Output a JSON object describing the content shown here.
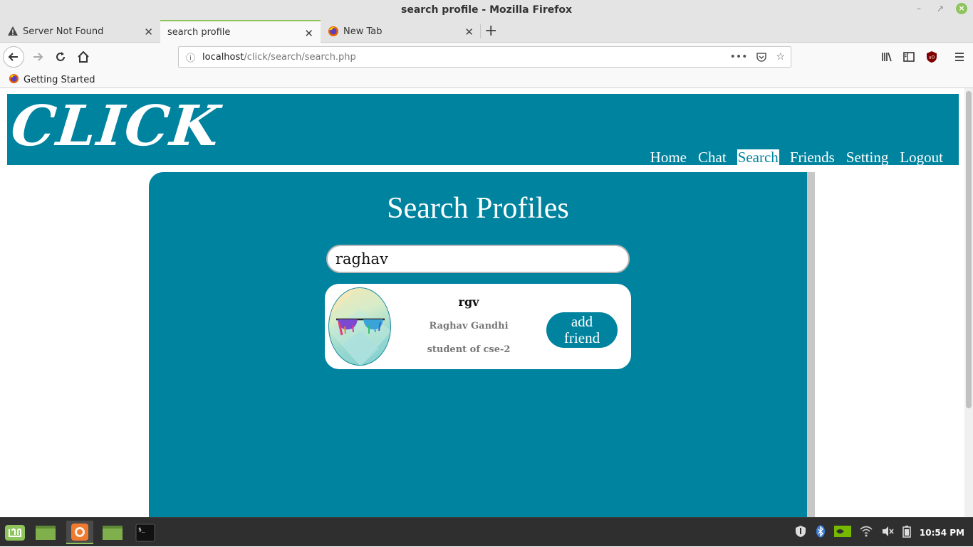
{
  "window": {
    "title": "search profile - Mozilla Firefox"
  },
  "tabs": [
    {
      "label": "Server Not Found"
    },
    {
      "label": "search profile"
    },
    {
      "label": "New Tab"
    }
  ],
  "urlbar": {
    "host": "localhost",
    "path": "/click/search/search.php"
  },
  "bookmarks": [
    {
      "label": "Getting Started"
    }
  ],
  "site": {
    "logo": "CLICK",
    "menu": [
      "Home",
      "Chat",
      "Search",
      "Friends",
      "Setting",
      "Logout"
    ],
    "active_menu": "Search"
  },
  "search": {
    "heading": "Search Profiles",
    "query": "raghav"
  },
  "results": [
    {
      "username": "rgv",
      "full_name": "Raghav Gandhi",
      "bio": "student of cse-2",
      "action_label_line1": "add",
      "action_label_line2": "friend"
    }
  ],
  "taskbar": {
    "clock": "10:54 PM"
  },
  "colors": {
    "accent": "#00839f",
    "tab_active": "#8fc45d"
  }
}
